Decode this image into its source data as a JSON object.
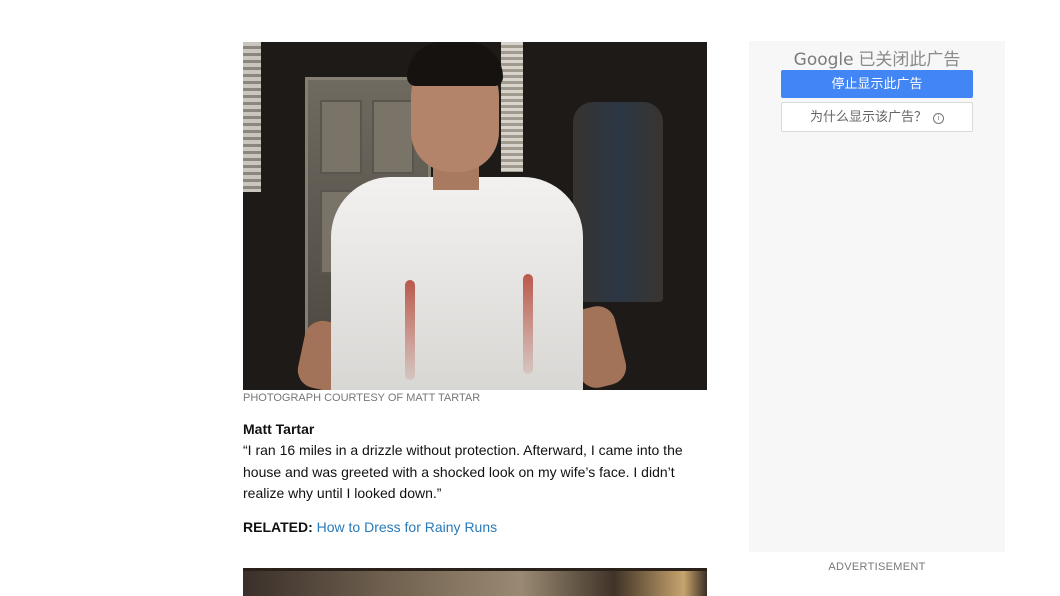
{
  "article": {
    "photo_credit": "PHOTOGRAPH COURTESY OF MATT TARTAR",
    "author": "Matt Tartar",
    "quote": "“I ran 16 miles in a drizzle without protection. Afterward, I came into the house and was greeted with a shocked look on my wife’s face. I didn’t realize why until I looked down.”",
    "related_label": "RELATED:",
    "related_link": "How to Dress for Rainy Runs"
  },
  "ad": {
    "brand": "Google",
    "closed_text": "已关闭此广告",
    "stop_button": "停止显示此广告",
    "why_button": "为什么显示该广告？",
    "info_glyph": "i",
    "label": "ADVERTISEMENT"
  },
  "colors": {
    "link": "#2a7ab8",
    "ad_button": "#4285f4"
  }
}
